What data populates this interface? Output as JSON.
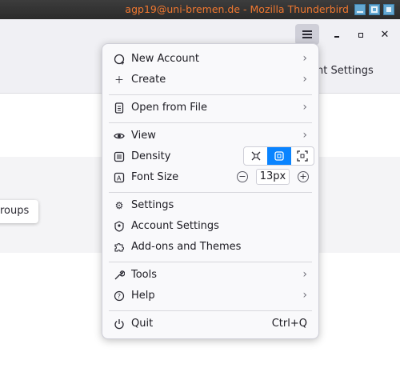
{
  "window": {
    "title": "agp19@uni-bremen.de - Mozilla Thunderbird"
  },
  "background": {
    "account_settings_tab": "nt Settings",
    "groups_chip": "roups"
  },
  "menu": {
    "new_account": "New Account",
    "create": "Create",
    "open_from_file": "Open from File",
    "view": "View",
    "density": "Density",
    "font_size": "Font Size",
    "font_size_value": "13px",
    "settings": "Settings",
    "account_settings": "Account Settings",
    "addons": "Add-ons and Themes",
    "tools": "Tools",
    "help": "Help",
    "quit": "Quit",
    "quit_shortcut": "Ctrl+Q",
    "density_selected": "normal"
  },
  "colors": {
    "accent": "#0a84ff",
    "title_text": "#f07830"
  }
}
